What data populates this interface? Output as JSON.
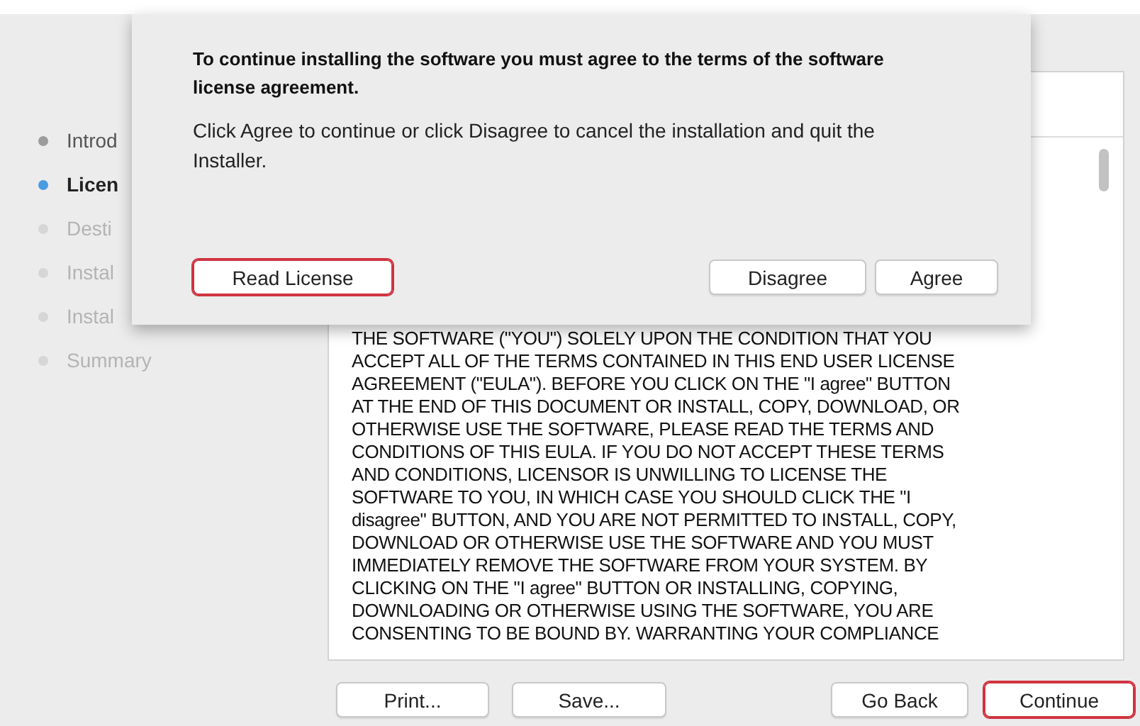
{
  "sidebar": {
    "items": [
      {
        "label": "Introd",
        "done": true,
        "selected": false
      },
      {
        "label": "Licen",
        "done": false,
        "selected": true
      },
      {
        "label": "Desti",
        "done": false,
        "selected": false
      },
      {
        "label": "Instal",
        "done": false,
        "selected": false
      },
      {
        "label": "Instal",
        "done": false,
        "selected": false
      },
      {
        "label": "Summary",
        "done": false,
        "selected": false
      }
    ]
  },
  "license_text": [
    "THE SOFTWARE (\"YOU\") SOLELY UPON THE CONDITION THAT YOU",
    "ACCEPT ALL OF THE TERMS CONTAINED IN THIS END USER LICENSE",
    "AGREEMENT (\"EULA\").  BEFORE YOU CLICK ON THE \"I agree\" BUTTON",
    "AT THE END OF THIS DOCUMENT OR INSTALL, COPY, DOWNLOAD, OR",
    "OTHERWISE USE THE SOFTWARE, PLEASE READ THE TERMS AND",
    "CONDITIONS OF THIS EULA.  IF YOU DO NOT ACCEPT THESE TERMS",
    "AND CONDITIONS, LICENSOR IS UNWILLING TO LICENSE THE",
    "SOFTWARE TO YOU, IN WHICH CASE YOU SHOULD CLICK THE \"I",
    "disagree\" BUTTON, AND YOU ARE NOT PERMITTED TO INSTALL, COPY,",
    "DOWNLOAD OR OTHERWISE USE THE SOFTWARE AND YOU MUST",
    "IMMEDIATELY REMOVE THE SOFTWARE FROM YOUR SYSTEM.  BY",
    "CLICKING ON THE \"I agree\" BUTTON OR INSTALLING, COPYING,",
    "DOWNLOADING OR OTHERWISE USING THE SOFTWARE, YOU ARE",
    "CONSENTING TO BE BOUND BY. WARRANTING YOUR COMPLIANCE"
  ],
  "bottom_buttons": {
    "left": [
      {
        "label": "Print...",
        "highlighted": false
      },
      {
        "label": "Save...",
        "highlighted": false
      }
    ],
    "right": [
      {
        "label": "Go Back",
        "highlighted": false
      },
      {
        "label": "Continue",
        "highlighted": true
      }
    ]
  },
  "sheet": {
    "title": "To continue installing the software you must agree to the terms of the software license agreement.",
    "message": "Click Agree to continue or click Disagree to cancel the installation and quit the Installer.",
    "left_buttons": [
      {
        "label": "Read License",
        "highlighted": true
      }
    ],
    "right_buttons": [
      {
        "label": "Disagree",
        "highlighted": false
      },
      {
        "label": "Agree",
        "highlighted": false
      }
    ]
  }
}
